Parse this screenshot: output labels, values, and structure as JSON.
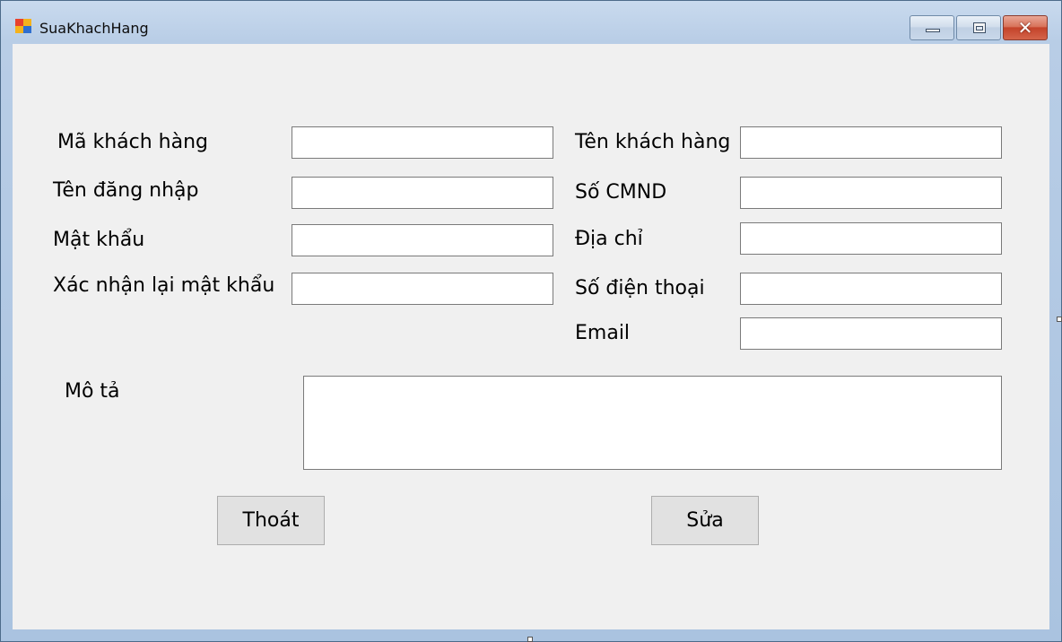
{
  "window": {
    "title": "SuaKhachHang",
    "icon": "winforms-app-icon",
    "controls": [
      "minimize-icon",
      "maximize-icon",
      "close-icon"
    ],
    "close_glyph": "✕"
  },
  "form": {
    "left": {
      "ma_khach_hang": {
        "label": "Mã khách hàng",
        "value": ""
      },
      "ten_dang_nhap": {
        "label": "Tên đăng nhập",
        "value": ""
      },
      "mat_khau": {
        "label": "Mật khẩu",
        "value": ""
      },
      "xac_nhan_mat_khau": {
        "label": "Xác nhận lại mật khẩu",
        "value": ""
      }
    },
    "right": {
      "ten_khach_hang": {
        "label": "Tên khách hàng",
        "value": ""
      },
      "so_cmnd": {
        "label": "Số CMND",
        "value": ""
      },
      "dia_chi": {
        "label": "Địa chỉ",
        "value": ""
      },
      "so_dien_thoai": {
        "label": "Số điện thoại",
        "value": ""
      },
      "email": {
        "label": "Email",
        "value": ""
      }
    },
    "mo_ta": {
      "label": "Mô tả",
      "value": ""
    }
  },
  "buttons": {
    "thoat": "Thoát",
    "sua": "Sửa"
  },
  "colors": {
    "client_background": "#f0f0f0",
    "titlebar": "#b8cde6",
    "close_button": "#c4432a"
  }
}
